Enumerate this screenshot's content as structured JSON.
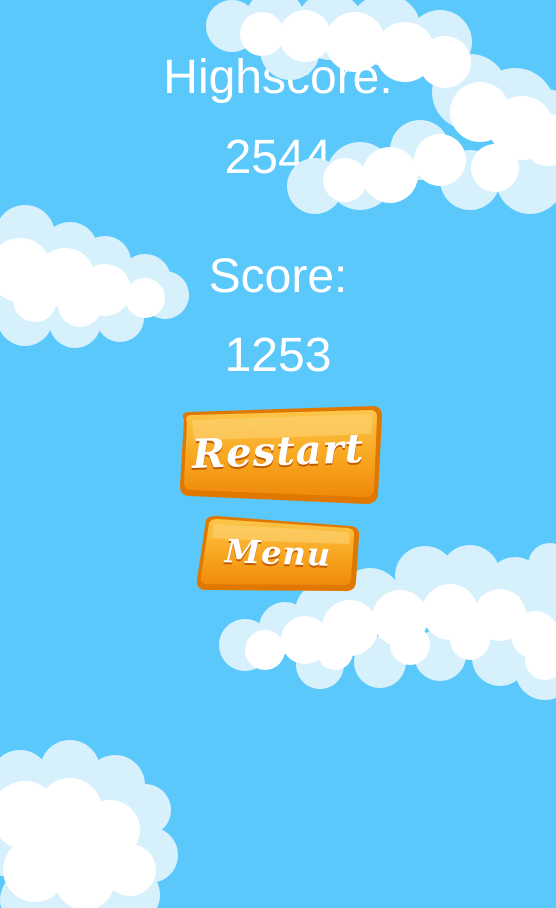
{
  "game": {
    "highscore_label": "Highscore:",
    "highscore_value": "2544",
    "score_label": "Score:",
    "score_value": "1253"
  },
  "buttons": {
    "restart_label": "Restart",
    "menu_label": "Menu"
  },
  "colors": {
    "sky": "#5ac8fa",
    "cloud": "#ffffff",
    "cloud_shadow": "#d6f0fc",
    "button_orange": "#f7a21a",
    "button_border": "#e07800"
  }
}
